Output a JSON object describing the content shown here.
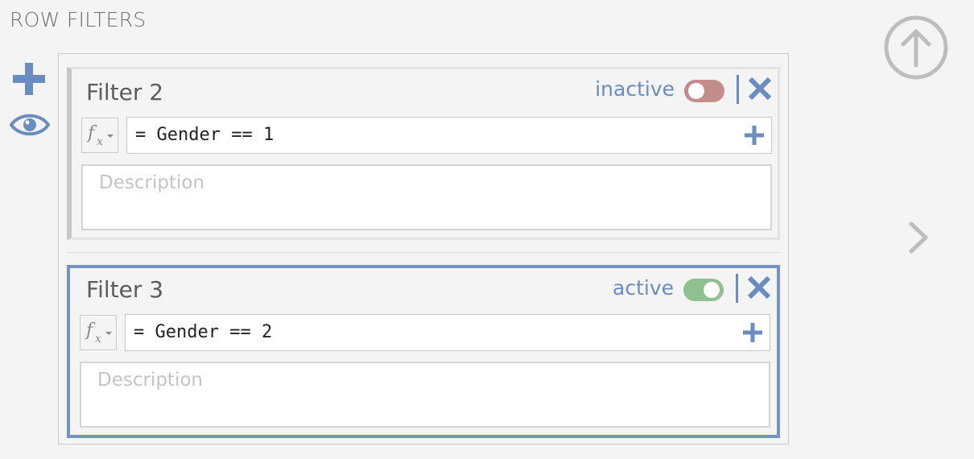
{
  "panel": {
    "title": "ROW FILTERS"
  },
  "icons": {
    "add": "plus-icon",
    "view": "eye-icon",
    "scroll_up": "arrow-up-circle-icon",
    "next": "chevron-right-icon",
    "remove": "close-icon",
    "function": "fx-icon",
    "add_formula": "plus-icon"
  },
  "colors": {
    "accent": "#6b8cbf",
    "inactive_toggle": "#c58c8c",
    "active_toggle": "#8fc08f",
    "active_border": "#7393c1"
  },
  "filters": [
    {
      "name": "Filter 2",
      "status": "inactive",
      "enabled": false,
      "formula": "= Gender == 1",
      "description_placeholder": "Description",
      "description": ""
    },
    {
      "name": "Filter 3",
      "status": "active",
      "enabled": true,
      "formula": "= Gender == 2",
      "description_placeholder": "Description",
      "description": ""
    }
  ]
}
